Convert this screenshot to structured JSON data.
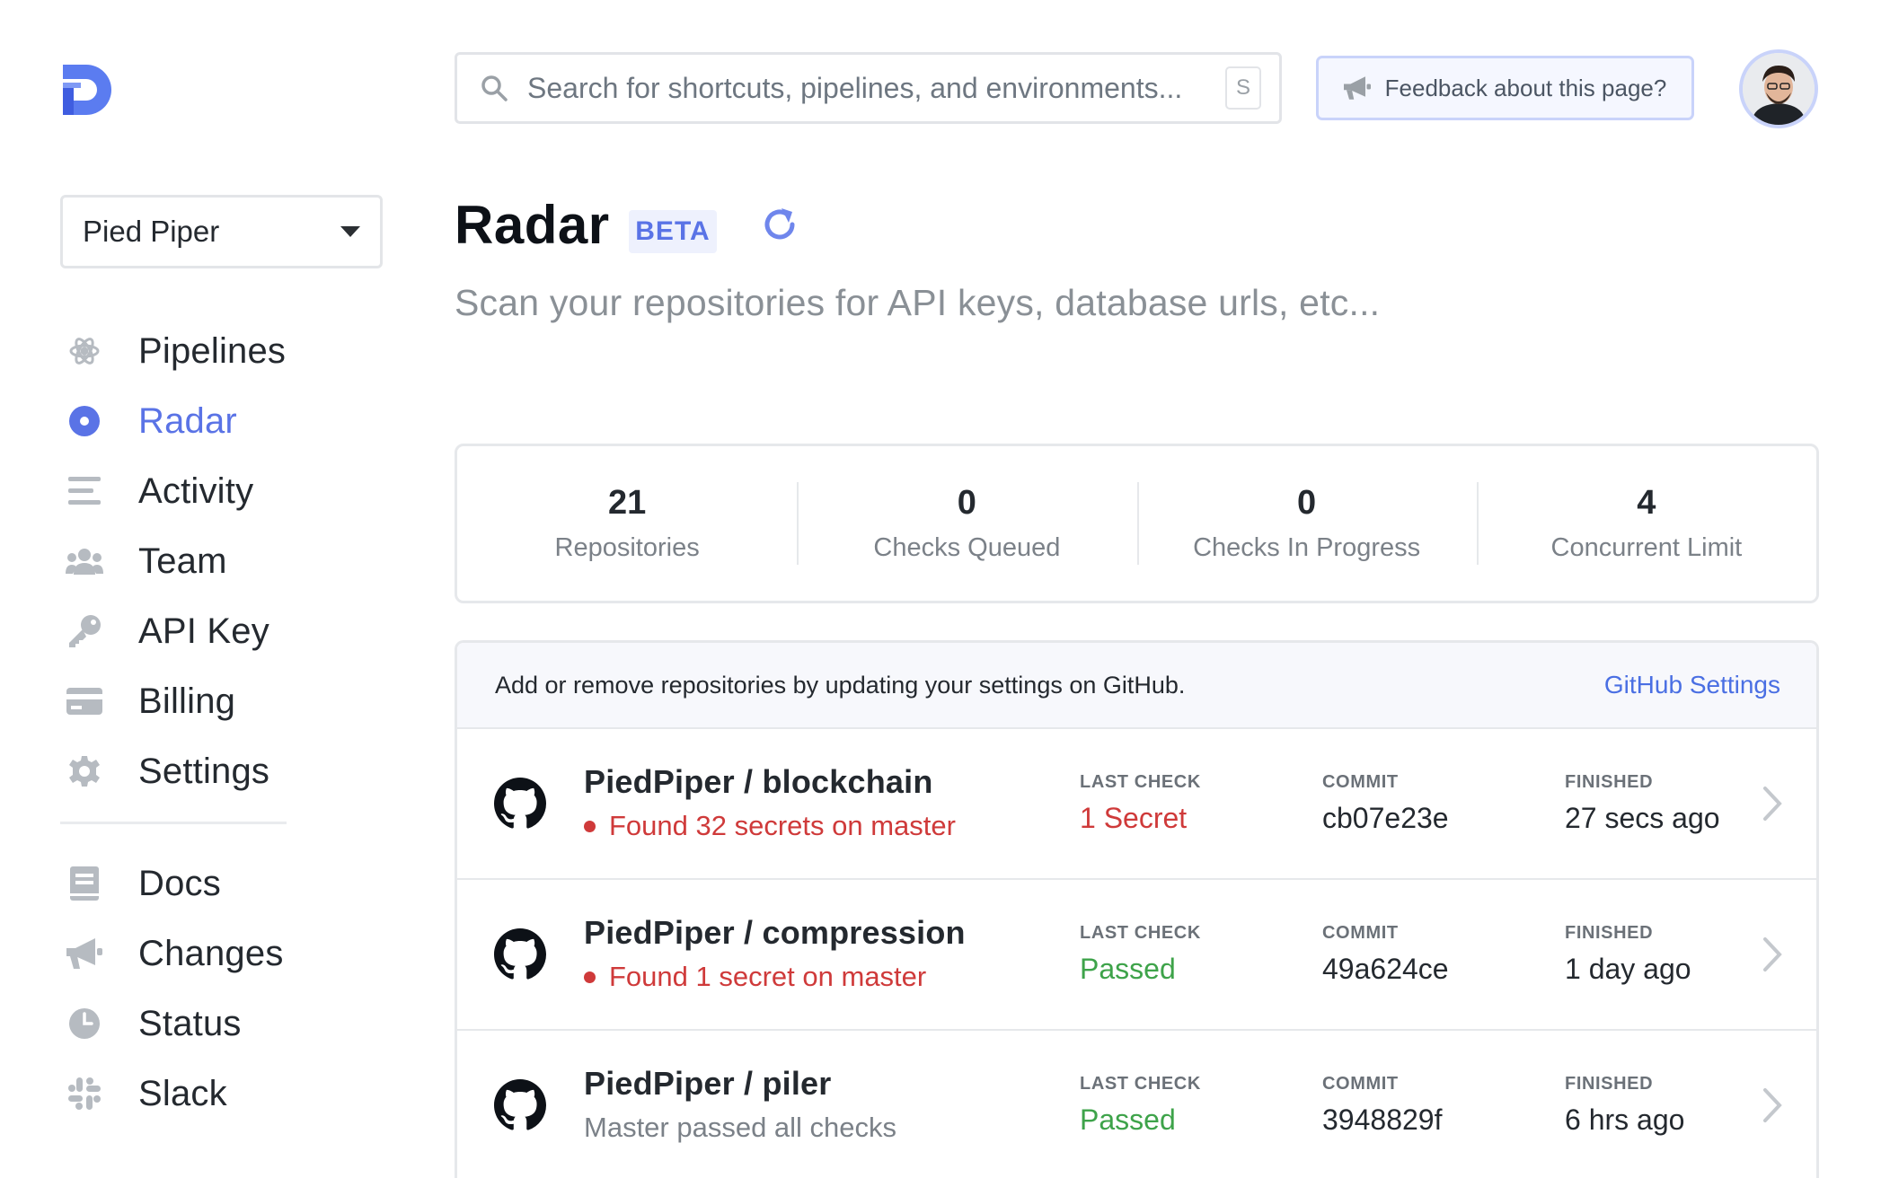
{
  "search": {
    "placeholder": "Search for shortcuts, pipelines, and environments...",
    "shortcut": "S"
  },
  "feedback": {
    "label": "Feedback about this page?"
  },
  "org": {
    "selected": "Pied Piper"
  },
  "nav": {
    "main": [
      {
        "label": "Pipelines",
        "icon": "atom-icon"
      },
      {
        "label": "Radar",
        "icon": "radar-dot-icon",
        "active": true
      },
      {
        "label": "Activity",
        "icon": "list-icon"
      },
      {
        "label": "Team",
        "icon": "users-icon"
      },
      {
        "label": "API Key",
        "icon": "key-icon"
      },
      {
        "label": "Billing",
        "icon": "credit-card-icon"
      },
      {
        "label": "Settings",
        "icon": "gear-icon"
      }
    ],
    "secondary": [
      {
        "label": "Docs",
        "icon": "book-icon"
      },
      {
        "label": "Changes",
        "icon": "megaphone-icon"
      },
      {
        "label": "Status",
        "icon": "clock-icon"
      },
      {
        "label": "Slack",
        "icon": "slack-icon"
      }
    ]
  },
  "header": {
    "title": "Radar",
    "badge": "BETA",
    "subtitle": "Scan your repositories for API keys, database urls, etc..."
  },
  "stats": [
    {
      "value": "21",
      "label": "Repositories"
    },
    {
      "value": "0",
      "label": "Checks Queued"
    },
    {
      "value": "0",
      "label": "Checks In Progress"
    },
    {
      "value": "4",
      "label": "Concurrent Limit"
    }
  ],
  "repos": {
    "note": "Add or remove repositories by updating your settings on GitHub.",
    "settings_link": "GitHub Settings",
    "columns": {
      "last_check": "LAST CHECK",
      "commit": "COMMIT",
      "finished": "FINISHED"
    },
    "items": [
      {
        "name": "PiedPiper / blockchain",
        "status": "Found 32 secrets on master",
        "alert": true,
        "last_check": "1 Secret",
        "last_check_state": "fail",
        "commit": "cb07e23e",
        "finished": "27 secs ago"
      },
      {
        "name": "PiedPiper / compression",
        "status": "Found 1 secret on master",
        "alert": true,
        "last_check": "Passed",
        "last_check_state": "pass",
        "commit": "49a624ce",
        "finished": "1 day ago"
      },
      {
        "name": "PiedPiper / piler",
        "status": "Master passed all checks",
        "alert": false,
        "last_check": "Passed",
        "last_check_state": "pass",
        "commit": "3948829f",
        "finished": "6 hrs ago"
      }
    ]
  },
  "colors": {
    "accent": "#5a73e6",
    "danger": "#cf3a3a",
    "success": "#3ea34a",
    "muted": "#7b8188"
  }
}
